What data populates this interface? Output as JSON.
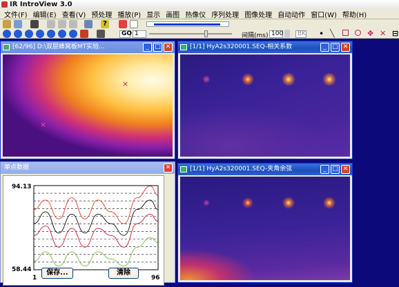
{
  "app": {
    "title": "IR IntroView 3.0"
  },
  "menu": [
    "文件(F)",
    "编辑(E)",
    "查看(V)",
    "预处理",
    "播放(P)",
    "显示",
    "画图",
    "热像仪",
    "序列处理",
    "图像处理",
    "自动动作",
    "窗口(W)",
    "帮助(H)"
  ],
  "toolbar": {
    "go_label": "GO",
    "frame_value": "1",
    "interval_label": "间隔(ms)",
    "interval_value": "100",
    "bk_label": "BK"
  },
  "windows": {
    "main_image": {
      "title": "[62/96] D:\\双层蜂窝板MT实验..."
    },
    "corr": {
      "title": "[1/1] HyA2s320001.SEQ-相关系数"
    },
    "cos": {
      "title": "[1/1] HyA2s320001.SEQ-夹角余弦"
    },
    "single": {
      "title": "单点数据",
      "y_max": "94.13",
      "y_min": "58.44",
      "x_min": "1",
      "x_max": "96",
      "save_label": "保存...",
      "clear_label": "清除"
    }
  },
  "chart_data": {
    "type": "line",
    "title": "",
    "xlabel": "",
    "ylabel": "",
    "xlim": [
      1,
      96
    ],
    "ylim": [
      58.44,
      94.13
    ],
    "x": [
      1,
      10,
      20,
      30,
      40,
      50,
      60,
      70,
      80,
      90,
      96
    ],
    "series": [
      {
        "color": "#e8503a",
        "values": [
          84,
          88,
          80,
          89,
          80,
          88,
          83,
          78,
          89,
          94,
          90
        ]
      },
      {
        "color": "#222222",
        "values": [
          78,
          83,
          74,
          82,
          74,
          82,
          78,
          73,
          84,
          88,
          84
        ]
      },
      {
        "color": "#d03048",
        "values": [
          73,
          77,
          68,
          76,
          68,
          76,
          73,
          68,
          78,
          82,
          79
        ]
      },
      {
        "color": "#8ac050",
        "values": [
          62,
          66,
          60,
          66,
          60,
          66,
          63,
          60,
          68,
          72,
          70
        ]
      }
    ],
    "grid": true
  }
}
